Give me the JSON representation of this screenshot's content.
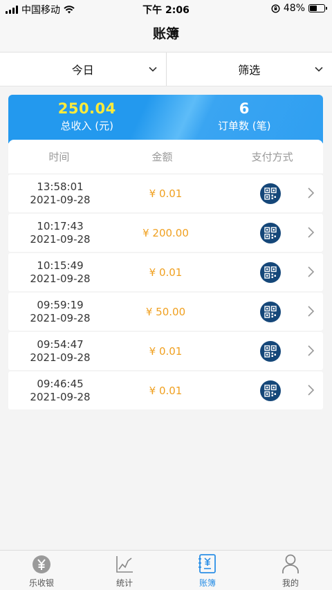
{
  "status_bar": {
    "carrier": "中国移动",
    "time": "下午 2:06",
    "battery": "48%",
    "battery_level": 0.48
  },
  "nav": {
    "title": "账簿"
  },
  "filters": {
    "date_label": "今日",
    "filter_label": "筛选"
  },
  "summary": {
    "income_value": "250.04",
    "income_label": "总收入 (元)",
    "orders_value": "6",
    "orders_label": "订单数 (笔)"
  },
  "table": {
    "headers": {
      "time": "时间",
      "amount": "金额",
      "pay": "支付方式"
    },
    "rows": [
      {
        "time": "13:58:01",
        "date": "2021-09-28",
        "amount": "¥  0.01",
        "pay_icon": "qr-pay-icon"
      },
      {
        "time": "10:17:43",
        "date": "2021-09-28",
        "amount": "¥  200.00",
        "pay_icon": "qr-pay-icon"
      },
      {
        "time": "10:15:49",
        "date": "2021-09-28",
        "amount": "¥  0.01",
        "pay_icon": "qr-pay-icon"
      },
      {
        "time": "09:59:19",
        "date": "2021-09-28",
        "amount": "¥  50.00",
        "pay_icon": "qr-pay-icon"
      },
      {
        "time": "09:54:47",
        "date": "2021-09-28",
        "amount": "¥  0.01",
        "pay_icon": "qr-pay-icon"
      },
      {
        "time": "09:46:45",
        "date": "2021-09-28",
        "amount": "¥  0.01",
        "pay_icon": "qr-pay-icon"
      }
    ]
  },
  "tabs": [
    {
      "label": "乐收银",
      "icon": "yen-coin-icon",
      "active": false
    },
    {
      "label": "统计",
      "icon": "chart-icon",
      "active": false
    },
    {
      "label": "账簿",
      "icon": "ledger-icon",
      "active": true
    },
    {
      "label": "我的",
      "icon": "user-icon",
      "active": false
    }
  ],
  "colors": {
    "accent": "#2b8fe6",
    "amount": "#f0a020",
    "income_value": "#ffeb3b",
    "pay_icon_bg": "#154779"
  }
}
